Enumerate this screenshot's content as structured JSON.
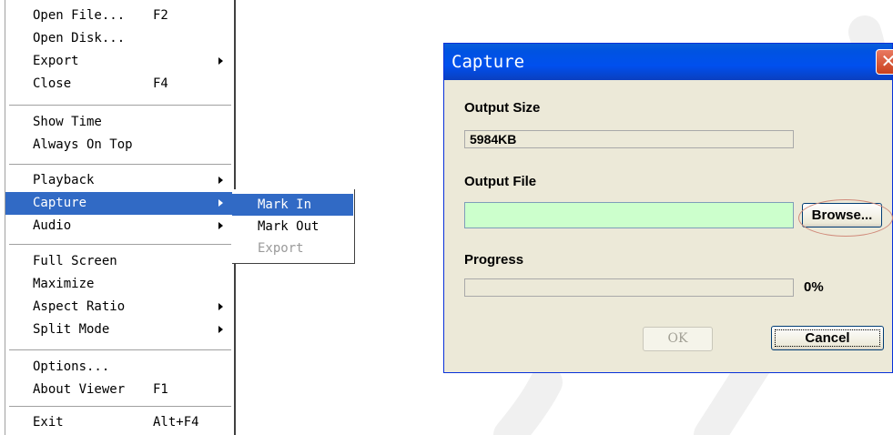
{
  "menu": {
    "items": [
      {
        "label": "Open File...",
        "accel": "F2"
      },
      {
        "label": "Open Disk...",
        "accel": ""
      },
      {
        "label": "Export",
        "accel": ""
      },
      {
        "label": "Close",
        "accel": "F4"
      },
      {
        "label": "Show Time",
        "accel": ""
      },
      {
        "label": "Always On Top",
        "accel": ""
      },
      {
        "label": "Playback",
        "accel": ""
      },
      {
        "label": "Capture",
        "accel": ""
      },
      {
        "label": "Audio",
        "accel": ""
      },
      {
        "label": "Full Screen",
        "accel": ""
      },
      {
        "label": "Maximize",
        "accel": ""
      },
      {
        "label": "Aspect Ratio",
        "accel": ""
      },
      {
        "label": "Split Mode",
        "accel": ""
      },
      {
        "label": "Options...",
        "accel": ""
      },
      {
        "label": "About Viewer",
        "accel": "F1"
      },
      {
        "label": "Exit",
        "accel": "Alt+F4"
      }
    ],
    "selected": "Capture"
  },
  "submenu": {
    "items": [
      {
        "label": "Mark In",
        "state": "selected"
      },
      {
        "label": "Mark Out",
        "state": "enabled"
      },
      {
        "label": "Export",
        "state": "disabled"
      }
    ]
  },
  "dialog": {
    "title": "Capture",
    "close_glyph": "✕",
    "output_size_label": "Output Size",
    "output_size_value": "5984KB",
    "output_file_label": "Output File",
    "output_file_value": "",
    "browse_label": "Browse...",
    "progress_label": "Progress",
    "progress_fraction": 0,
    "progress_text": "0%",
    "ok_label": "OK",
    "cancel_label": "Cancel"
  },
  "colors": {
    "menu_highlight": "#316ac5",
    "titlebar": "#0054e3",
    "dialog_bg": "#ece9d8",
    "output_file_bg": "#ccffcc",
    "close_button": "#d9532c",
    "annotation_circle": "#d08a7a"
  }
}
